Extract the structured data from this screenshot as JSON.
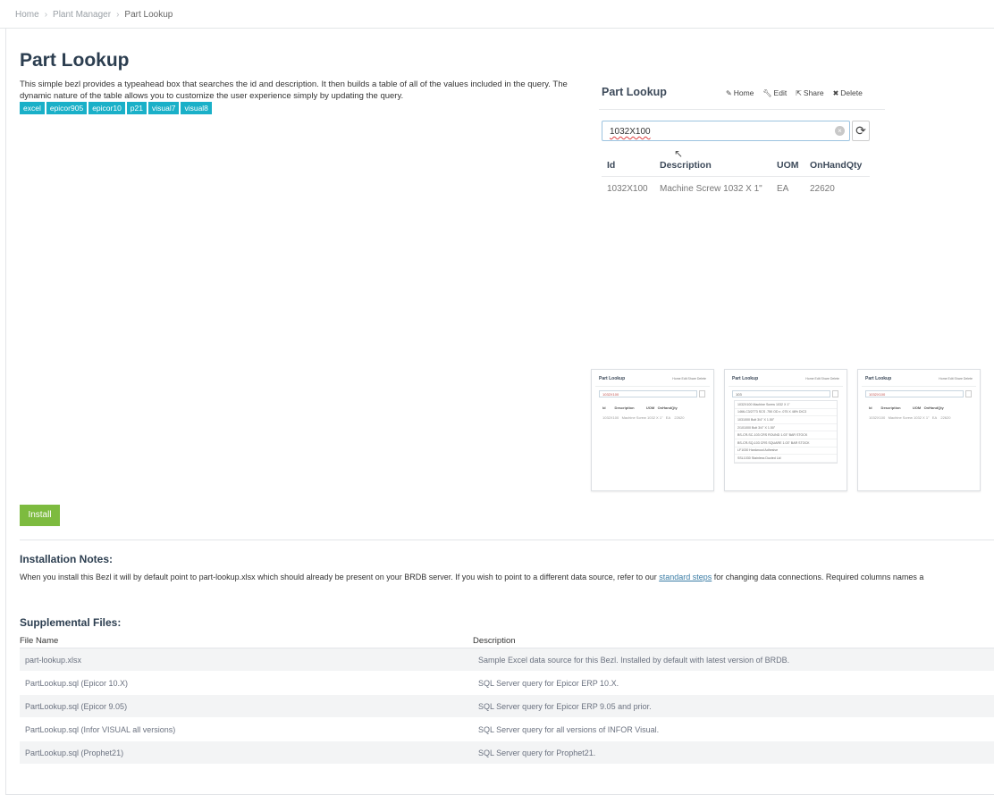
{
  "breadcrumb": {
    "items": [
      "Home",
      "Plant Manager",
      "Part Lookup"
    ]
  },
  "page": {
    "title": "Part Lookup",
    "intro": "This simple bezl provides a typeahead box that searches the id and description. It then builds a table of all of the values included in the query. The dynamic nature of the table allows you to customize the user experience simply by updating the query.",
    "tags": [
      "excel",
      "epicor905",
      "epicor10",
      "p21",
      "visual7",
      "visual8"
    ]
  },
  "demo": {
    "title": "Part Lookup",
    "actions": {
      "home": "Home",
      "edit": "Edit",
      "share": "Share",
      "delete": "Delete"
    },
    "search_value": "1032X100",
    "columns": [
      "Id",
      "Description",
      "UOM",
      "OnHandQty"
    ],
    "row": {
      "id": "1032X100",
      "description": "Machine Screw 1032 X 1\"",
      "uom": "EA",
      "qty": "22620"
    }
  },
  "thumbnails": [
    {
      "title": "Part Lookup",
      "search": "1032X100",
      "head": "Id         Description            UOM   OnHandQty",
      "row": "1032X100   Machine Screw 1032 X 1\"   EA    22620"
    },
    {
      "title": "Part Lookup",
      "search": "103",
      "list": [
        "1032X100 Machine Screw 1032 X 1\"",
        "1466-C3/2773 SCS .750 OD x .075 X 48% DIC3",
        "1031000 Bolt 3/4\" X 1.50\"",
        "2/101000 Bolt 3/4\" X 1.50\"",
        "BS-CR-SC-103 CRS ROUND 1.03\" BAR STOCK",
        "BS-CR-SQ-103 CRS SQUARE 1.03\" BAR STOCK",
        "LF1030 Hardwood Adhesive",
        "SSL1030 Stainless Ducted Lid"
      ]
    },
    {
      "title": "Part Lookup",
      "search": "1032X100",
      "head": "Id         Description            UOM   OnHandQty",
      "row": "1032X100   Machine Screw 1032 X 1\"   EA    22620"
    }
  ],
  "install_label": "Install",
  "notes": {
    "heading": "Installation Notes:",
    "text_before": "When you install this Bezl it will by default point to part-lookup.xlsx which should already be present on your BRDB server. If you wish to point to a different data source, refer to our ",
    "link": "standard steps",
    "text_after": " for changing data connections. Required columns names a"
  },
  "supplemental": {
    "heading": "Supplemental Files:",
    "columns": [
      "File Name",
      "Description"
    ],
    "rows": [
      [
        "part-lookup.xlsx",
        "Sample Excel data source for this Bezl. Installed by default with latest version of BRDB."
      ],
      [
        "PartLookup.sql (Epicor 10.X)",
        "SQL Server query for Epicor ERP 10.X."
      ],
      [
        "PartLookup.sql (Epicor 9.05)",
        "SQL Server query for Epicor ERP 9.05 and prior."
      ],
      [
        "PartLookup.sql (Infor VISUAL all versions)",
        "SQL Server query for all versions of INFOR Visual."
      ],
      [
        "PartLookup.sql (Prophet21)",
        "SQL Server query for Prophet21."
      ]
    ]
  }
}
